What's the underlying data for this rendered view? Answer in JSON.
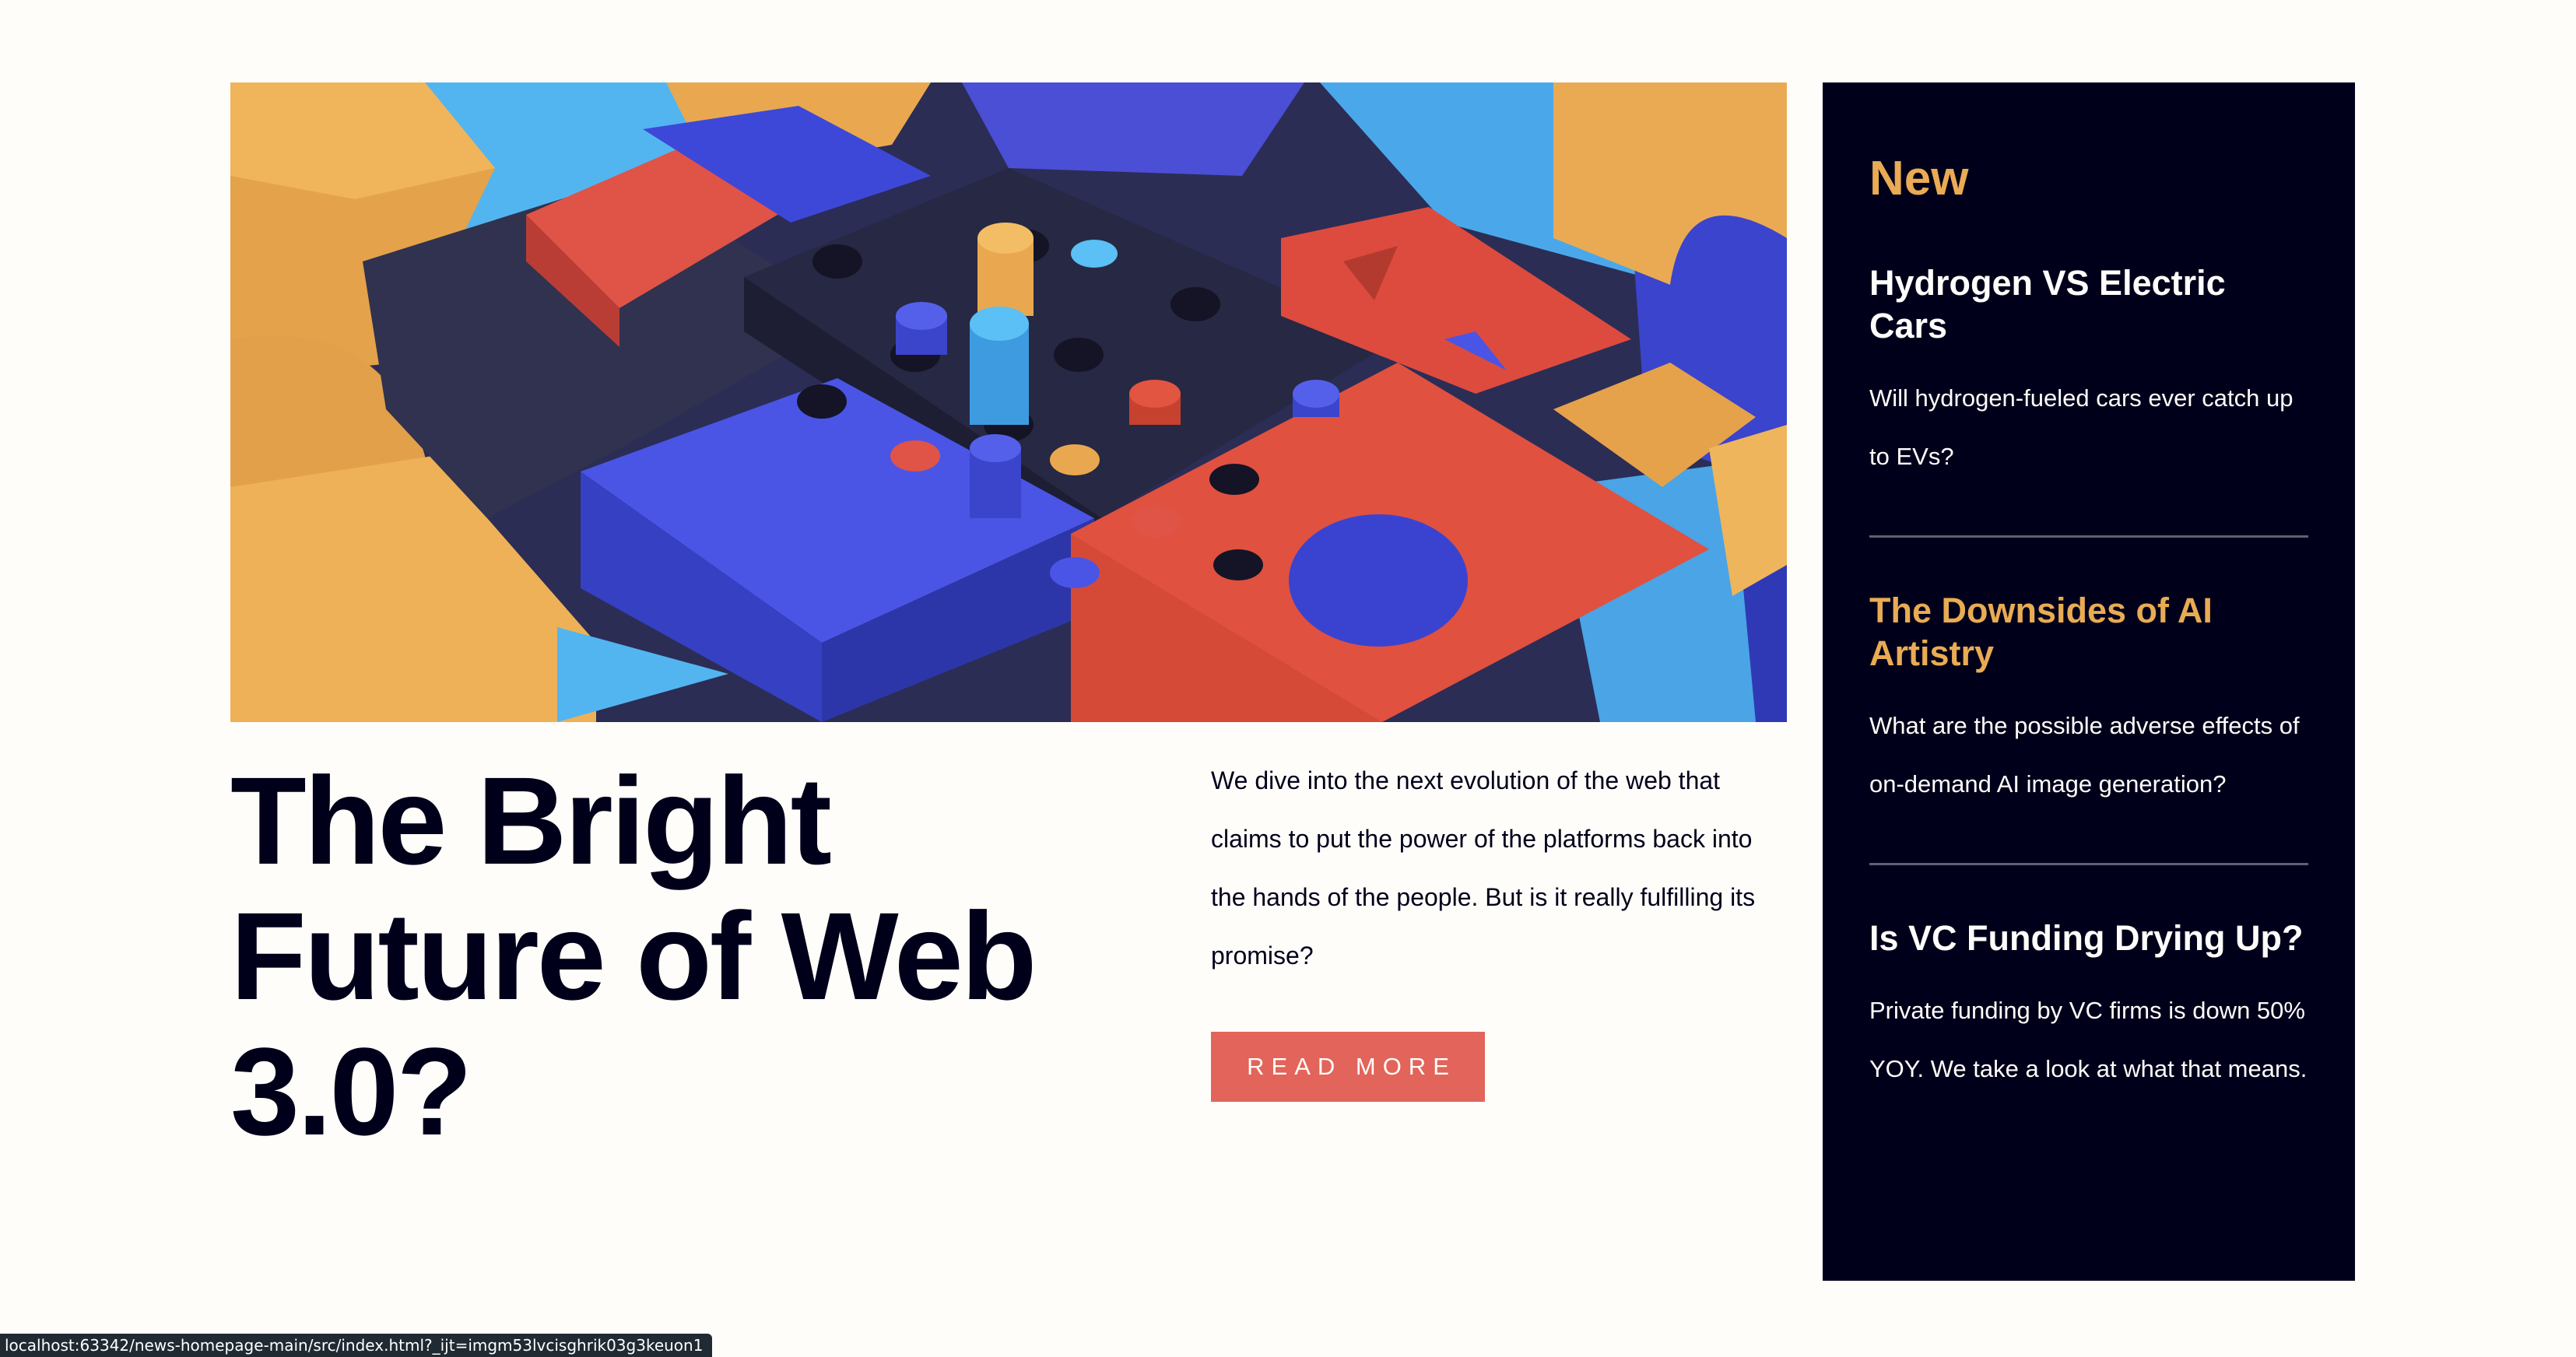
{
  "hero": {
    "image_alt": "colorful 3D geometric blocks",
    "headline_line1": "The Bright",
    "headline_line2": "Future of Web",
    "headline_line3": "3.0?",
    "intro": "We dive into the next evolution of the web that claims to put the power of the platforms back into the hands of the people. But is it really fulfilling its promise?",
    "button_label": "READ MORE"
  },
  "sidebar": {
    "title": "New",
    "items": [
      {
        "title": "Hydrogen VS Electric Cars",
        "text": "Will hydrogen-fueled cars ever catch up to EVs?"
      },
      {
        "title": "The Downsides of AI Artistry",
        "text": "What are the possible adverse effects of on-demand AI image generation?"
      },
      {
        "title": "Is VC Funding Drying Up?",
        "text": "Private funding by VC firms is down 50% YOY. We take a look at what that means."
      }
    ]
  },
  "status_bar": {
    "url": "localhost:63342/news-homepage-main/src/index.html?_ijt=imgm53lvcisghrik03g3keuon1"
  },
  "colors": {
    "background": "#fffdfa",
    "dark_navy": "#00001a",
    "accent_red": "#e2645a",
    "accent_orange": "#e9ab53",
    "divider": "#5e607a"
  }
}
